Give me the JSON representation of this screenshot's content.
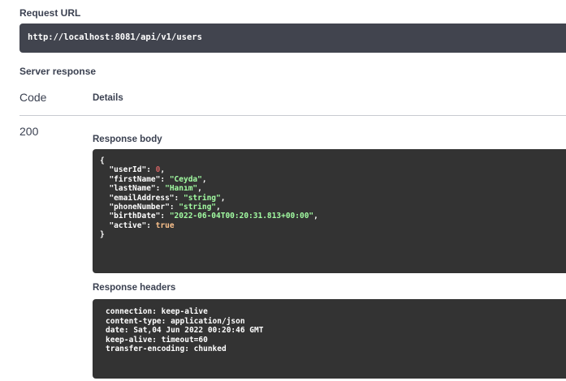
{
  "request_url": {
    "label": "Request URL",
    "value": "http://localhost:8081/api/v1/users"
  },
  "server_response": {
    "label": "Server response",
    "columns": {
      "code": "Code",
      "details": "Details"
    },
    "code": "200",
    "response_body": {
      "label": "Response body",
      "open_brace": "{",
      "close_brace": "}",
      "fields": [
        {
          "key": "\"userId\"",
          "value": "0",
          "type": "num",
          "comma": ","
        },
        {
          "key": "\"firstName\"",
          "value": "\"Ceyda\"",
          "type": "str",
          "comma": ","
        },
        {
          "key": "\"lastName\"",
          "value": "\"Hanım\"",
          "type": "str",
          "comma": ","
        },
        {
          "key": "\"emailAddress\"",
          "value": "\"string\"",
          "type": "str",
          "comma": ","
        },
        {
          "key": "\"phoneNumber\"",
          "value": "\"string\"",
          "type": "str",
          "comma": ","
        },
        {
          "key": "\"birthDate\"",
          "value": "\"2022-06-04T00:20:31.813+00:00\"",
          "type": "str",
          "comma": ","
        },
        {
          "key": "\"active\"",
          "value": "true",
          "type": "bool",
          "comma": ""
        }
      ]
    },
    "response_headers": {
      "label": "Response headers",
      "lines": [
        "connection: keep-alive",
        "content-type: application/json",
        "date: Sat,04 Jun 2022 00:20:46 GMT",
        "keep-alive: timeout=60",
        "transfer-encoding: chunked"
      ]
    }
  },
  "colors": {
    "url_bg": "#41444e",
    "code_bg": "#333333",
    "string": "#a2fca2",
    "number": "#d36363",
    "boolean": "#fcc28c"
  }
}
